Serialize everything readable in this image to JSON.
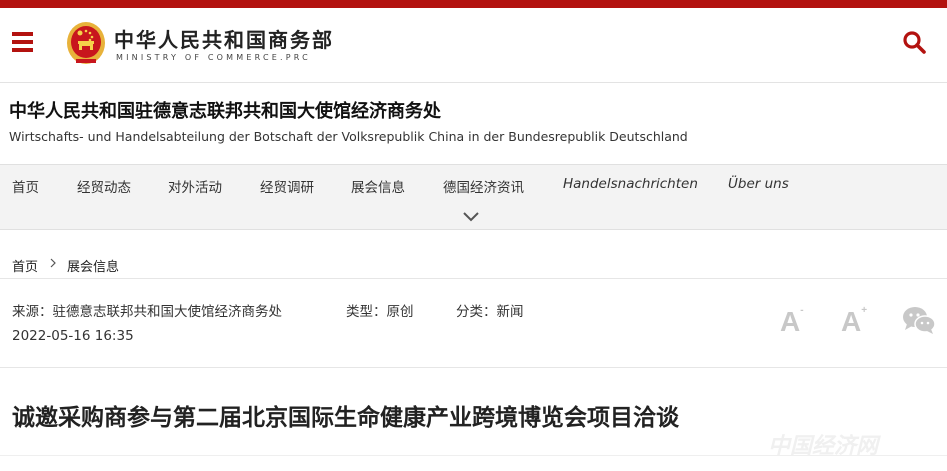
{
  "colors": {
    "brand_red": "#b3120f",
    "nav_bg": "#f3f3f3",
    "icon_gray": "#c8c8c8"
  },
  "header": {
    "logo_cn": "中华人民共和国商务部",
    "logo_en": "MINISTRY OF COMMERCE.PRC",
    "menu_icon": "hamburger-menu-icon",
    "search_icon": "search-icon"
  },
  "site": {
    "title": "中华人民共和国驻德意志联邦共和国大使馆经济商务处",
    "subtitle": "Wirtschafts- und Handelsabteilung der Botschaft der Volksrepublik China in der Bundesrepublik Deutschland"
  },
  "nav": {
    "items": [
      {
        "label": "首页"
      },
      {
        "label": "经贸动态"
      },
      {
        "label": "对外活动"
      },
      {
        "label": "经贸调研"
      },
      {
        "label": "展会信息"
      },
      {
        "label": "德国经济资讯"
      },
      {
        "label": "Handelsnachrichten"
      },
      {
        "label": "Über uns"
      }
    ],
    "expand_icon": "chevron-down-icon"
  },
  "breadcrumb": {
    "home": "首页",
    "current": "展会信息"
  },
  "meta": {
    "source": "来源：驻德意志联邦共和国大使馆经济商务处",
    "type": "类型：原创",
    "category": "分类：新闻",
    "date": "2022-05-16 16:35"
  },
  "tools": {
    "font_decrease": "A",
    "font_decrease_sup": "-",
    "font_increase": "A",
    "font_increase_sup": "+",
    "share_icon": "wechat-icon"
  },
  "article": {
    "title": "诚邀采购商参与第二届北京国际生命健康产业跨境博览会项目洽谈"
  },
  "watermark": "中国经济网"
}
